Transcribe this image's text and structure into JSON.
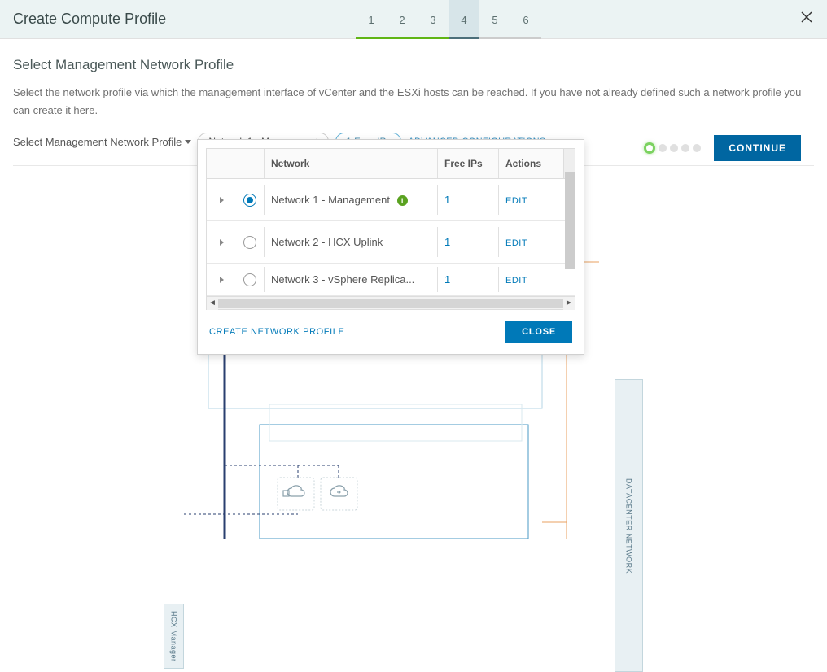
{
  "header": {
    "title": "Create Compute Profile",
    "steps": [
      "1",
      "2",
      "3",
      "4",
      "5",
      "6"
    ],
    "active_step_index": 3,
    "continue_label": "CONTINUE"
  },
  "section": {
    "title": "Select Management Network Profile",
    "description": "Select the network profile via which the management interface of vCenter and the ESXi hosts can be reached. If you have not already defined such a network profile you can create it here.",
    "select_label": "Select Management Network Profile",
    "selected_chip": "Network 1 - Management",
    "freeips_chip": "1 Free IPs",
    "advanced_label": "ADVANCED CONFIGURATIONS"
  },
  "dropdown": {
    "columns": {
      "network": "Network",
      "freeips": "Free IPs",
      "actions": "Actions"
    },
    "rows": [
      {
        "name": "Network 1 - Management",
        "free_ips": "1",
        "action": "EDIT",
        "selected": true,
        "has_info": true
      },
      {
        "name": "Network 2 - HCX Uplink",
        "free_ips": "1",
        "action": "EDIT",
        "selected": false,
        "has_info": false
      },
      {
        "name": "Network 3 - vSphere Replica...",
        "free_ips": "1",
        "action": "EDIT",
        "selected": false,
        "has_info": false
      }
    ],
    "create_label": "CREATE NETWORK PROFILE",
    "close_label": "CLOSE"
  },
  "diagram": {
    "hcx_label": "HCX Manager",
    "dc_label": "DATACENTER NETWORK"
  }
}
